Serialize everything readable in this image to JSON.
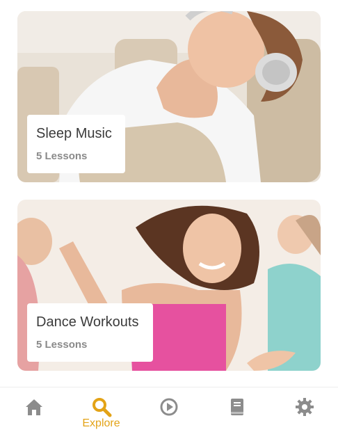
{
  "cards": [
    {
      "title": "Sleep Music",
      "subtitle": "5 Lessons"
    },
    {
      "title": "Dance Workouts",
      "subtitle": "5 Lessons"
    }
  ],
  "tabbar": {
    "active_color": "#e3a317",
    "inactive_color": "#8c8c8c",
    "tabs": [
      {
        "icon": "home-icon",
        "label": ""
      },
      {
        "icon": "search-icon",
        "label": "Explore",
        "active": true
      },
      {
        "icon": "play-circle-icon",
        "label": ""
      },
      {
        "icon": "book-icon",
        "label": ""
      },
      {
        "icon": "gear-icon",
        "label": ""
      }
    ]
  }
}
